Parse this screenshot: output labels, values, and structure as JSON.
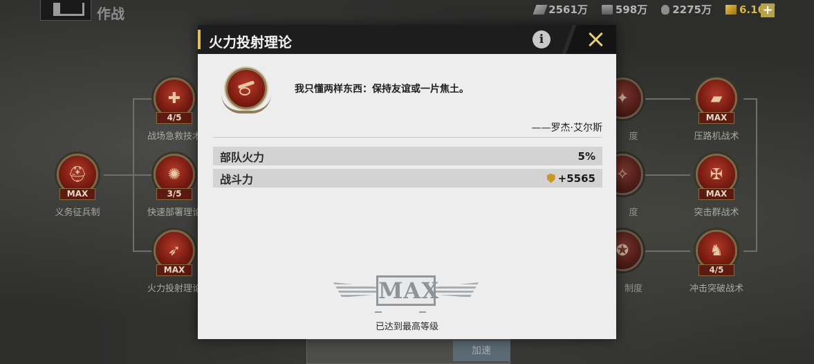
{
  "topbar": {
    "title": "作战",
    "resources": [
      {
        "icon": "money-icon",
        "value": "2561万"
      },
      {
        "icon": "steel-icon",
        "value": "598万"
      },
      {
        "icon": "oil-icon",
        "value": "2275万"
      },
      {
        "icon": "gold-icon",
        "value": "6.16万"
      }
    ],
    "add_label": "+"
  },
  "tree": {
    "nodes": [
      {
        "label": "义务征兵制",
        "level": "MAX",
        "icon": "helmet-icon"
      },
      {
        "label": "战场急救技术",
        "level": "4/5",
        "icon": "medkit-icon"
      },
      {
        "label": "快速部署理论",
        "level": "3/5",
        "icon": "deploy-icon"
      },
      {
        "label": "火力投射理论",
        "level": "MAX",
        "icon": "cannon-icon"
      },
      {
        "label": "压路机战术",
        "level": "MAX",
        "icon": "tank-icon"
      },
      {
        "label": "突击群战术",
        "level": "MAX",
        "icon": "assault-icon"
      },
      {
        "label": "冲击突破战术",
        "level": "4/5",
        "icon": "soldier-icon"
      }
    ],
    "partial_labels": [
      "度",
      "度",
      "制度"
    ]
  },
  "bottom": {
    "button_label": "加速"
  },
  "modal": {
    "title": "火力投射理论",
    "info_label": "i",
    "quote": "我只懂两样东西：保持友谊或一片焦土。",
    "author": "——罗杰·艾尔斯",
    "stats": [
      {
        "label": "部队火力",
        "value": "5%"
      },
      {
        "label": "战斗力",
        "value": "+5565",
        "icon": "power-icon"
      }
    ],
    "max_label": "MAX",
    "max_caption": "已达到最高等级"
  },
  "colors": {
    "accent": "#e0c15a",
    "header_bg": "#1d1d1d",
    "modal_bg": "#ededed",
    "badge_red": "#7e1c12"
  }
}
